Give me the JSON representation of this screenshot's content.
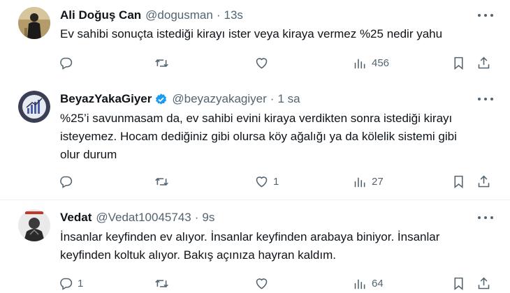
{
  "tweets": [
    {
      "name": "Ali Doğuş Can",
      "handle": "@dogusman",
      "separator": "·",
      "time": "13s",
      "verified": false,
      "lines": [
        "Ev sahibi sonuçta istediği kirayı ister veya kiraya vermez %25 nedir yahu"
      ],
      "reply_count": "",
      "retweet_count": "",
      "like_count": "",
      "view_count": "456"
    },
    {
      "name": "BeyazYakaGiyer",
      "handle": "@beyazyakagiyer",
      "separator": "·",
      "time": "1 sa",
      "verified": true,
      "lines": [
        "%25’i savunmasam da, ev sahibi evini kiraya verdikten sonra istediği kirayı",
        "isteyemez. Hocam dediğiniz gibi olursa köy ağalığı ya da kölelik sistemi gibi",
        "olur durum"
      ],
      "reply_count": "",
      "retweet_count": "",
      "like_count": "1",
      "view_count": "27"
    },
    {
      "name": "Vedat",
      "handle": "@Vedat10045743",
      "separator": "·",
      "time": "9s",
      "verified": false,
      "lines": [
        "İnsanlar keyfinden ev alıyor. İnsanlar keyfinden arabaya biniyor. İnsanlar",
        "keyfinden koltuk alıyor. Bakış açınıza hayran kaldım."
      ],
      "reply_count": "1",
      "retweet_count": "",
      "like_count": "",
      "view_count": "64"
    }
  ],
  "icons": {
    "reply": "reply-icon",
    "retweet": "retweet-icon",
    "like": "heart-icon",
    "views": "views-icon",
    "bookmark": "bookmark-icon",
    "share": "share-icon",
    "more": "more-icon",
    "verified": "verified-badge-icon"
  },
  "colors": {
    "text": "#0f1419",
    "secondary": "#536471",
    "verified": "#1d9bf0",
    "divider": "#eff3f4"
  }
}
